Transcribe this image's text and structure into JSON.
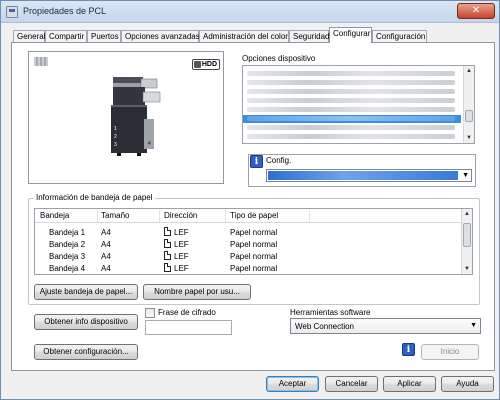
{
  "window": {
    "title": "Propiedades de PCL",
    "close_glyph": "✕"
  },
  "tabs": [
    {
      "label": "General",
      "active": false
    },
    {
      "label": "Compartir",
      "active": false
    },
    {
      "label": "Puertos",
      "active": false
    },
    {
      "label": "Opciones avanzadas",
      "active": false
    },
    {
      "label": "Administración del color",
      "active": false
    },
    {
      "label": "Seguridad",
      "active": false
    },
    {
      "label": "Configurar",
      "active": true
    },
    {
      "label": "Configuración",
      "active": false
    }
  ],
  "preview": {
    "hdd_badge": "HDD",
    "tray_numbers": [
      "1",
      "2",
      "3"
    ],
    "output_number": "4"
  },
  "device_options": {
    "label": "Opciones dispositivo",
    "selected_index": 6
  },
  "config": {
    "label": "Config."
  },
  "tray_group": {
    "title": "Información de bandeja de papel",
    "columns": [
      "Bandeja",
      "Tamaño",
      "Dirección",
      "Tipo de papel"
    ],
    "rows": [
      {
        "tray": "Bandeja 1",
        "size": "A4",
        "direction": "LEF",
        "type": "Papel normal"
      },
      {
        "tray": "Bandeja 2",
        "size": "A4",
        "direction": "LEF",
        "type": "Papel normal"
      },
      {
        "tray": "Bandeja 3",
        "size": "A4",
        "direction": "LEF",
        "type": "Papel normal"
      },
      {
        "tray": "Bandeja 4",
        "size": "A4",
        "direction": "LEF",
        "type": "Papel normal"
      }
    ],
    "adjust_button": "Ajuste bandeja de papel...",
    "paper_name_button": "Nombre papel por usu..."
  },
  "buttons": {
    "get_device_info": "Obtener info dispositivo",
    "get_config": "Obtener configuración...",
    "start": "Inicio",
    "ok": "Aceptar",
    "cancel": "Cancelar",
    "apply": "Aplicar",
    "help": "Ayuda"
  },
  "passphrase": {
    "label": "Frase de cifrado",
    "checked": false,
    "value": ""
  },
  "software": {
    "label": "Herramientas software",
    "selected": "Web Connection"
  },
  "icons": {
    "info": "i",
    "dropdown": "▼",
    "scroll_up": "▲",
    "scroll_down": "▼"
  },
  "colors": {
    "selection": "#3e8ee0",
    "info_icon": "#2f5fbf"
  }
}
